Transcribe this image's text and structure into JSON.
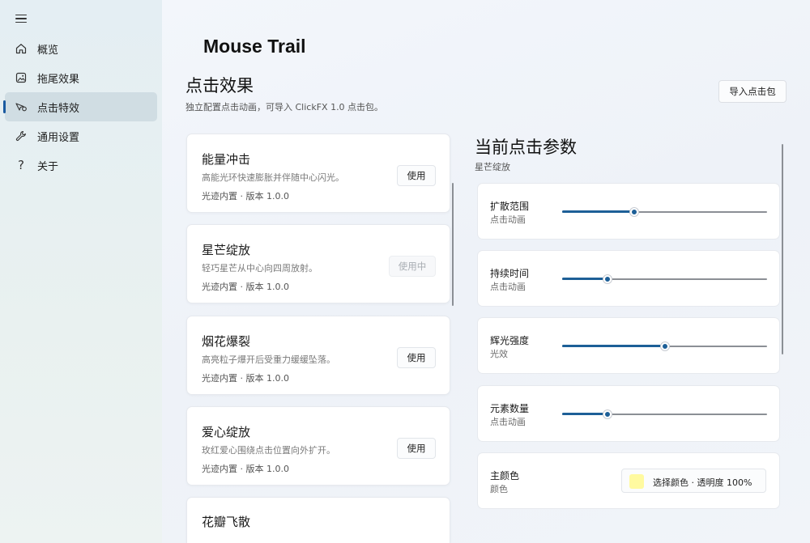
{
  "nav": {
    "items": [
      {
        "label": "概览",
        "icon": "home-icon"
      },
      {
        "label": "拖尾效果",
        "icon": "image-icon"
      },
      {
        "label": "点击特效",
        "icon": "pointer-effect-icon"
      },
      {
        "label": "通用设置",
        "icon": "wrench-icon"
      },
      {
        "label": "关于",
        "icon": "question-icon"
      }
    ],
    "active_index": 2
  },
  "header": {
    "app_title": "Mouse Trail",
    "section_title": "点击效果",
    "section_desc": "独立配置点击动画，可导入 ClickFX 1.0 点击包。",
    "import_label": "导入点击包"
  },
  "effects": [
    {
      "name": "能量冲击",
      "desc": "高能光环快速膨胀并伴随中心闪光。",
      "meta": "光迹内置 · 版本 1.0.0",
      "button": "使用",
      "active": false
    },
    {
      "name": "星芒绽放",
      "desc": "轻巧星芒从中心向四周放射。",
      "meta": "光迹内置 · 版本 1.0.0",
      "button": "使用中",
      "active": true
    },
    {
      "name": "烟花爆裂",
      "desc": "高亮粒子爆开后受重力缓缓坠落。",
      "meta": "光迹内置 · 版本 1.0.0",
      "button": "使用",
      "active": false
    },
    {
      "name": "爱心绽放",
      "desc": "玫红爱心围绕点击位置向外扩开。",
      "meta": "光迹内置 · 版本 1.0.0",
      "button": "使用",
      "active": false
    },
    {
      "name": "花瓣飞散"
    }
  ],
  "panel": {
    "title": "当前点击参数",
    "subtitle": "星芒绽放",
    "params": [
      {
        "name": "扩散范围",
        "sub": "点击动画",
        "value": 0.35
      },
      {
        "name": "持续时间",
        "sub": "点击动画",
        "value": 0.22
      },
      {
        "name": "辉光强度",
        "sub": "光效",
        "value": 0.5
      },
      {
        "name": "元素数量",
        "sub": "点击动画",
        "value": 0.22
      }
    ],
    "color": {
      "name": "主颜色",
      "sub": "颜色",
      "button_label": "选择颜色 · 透明度 100%",
      "swatch": "#fffaa0"
    }
  },
  "colors": {
    "accent": "#1d5f97"
  }
}
